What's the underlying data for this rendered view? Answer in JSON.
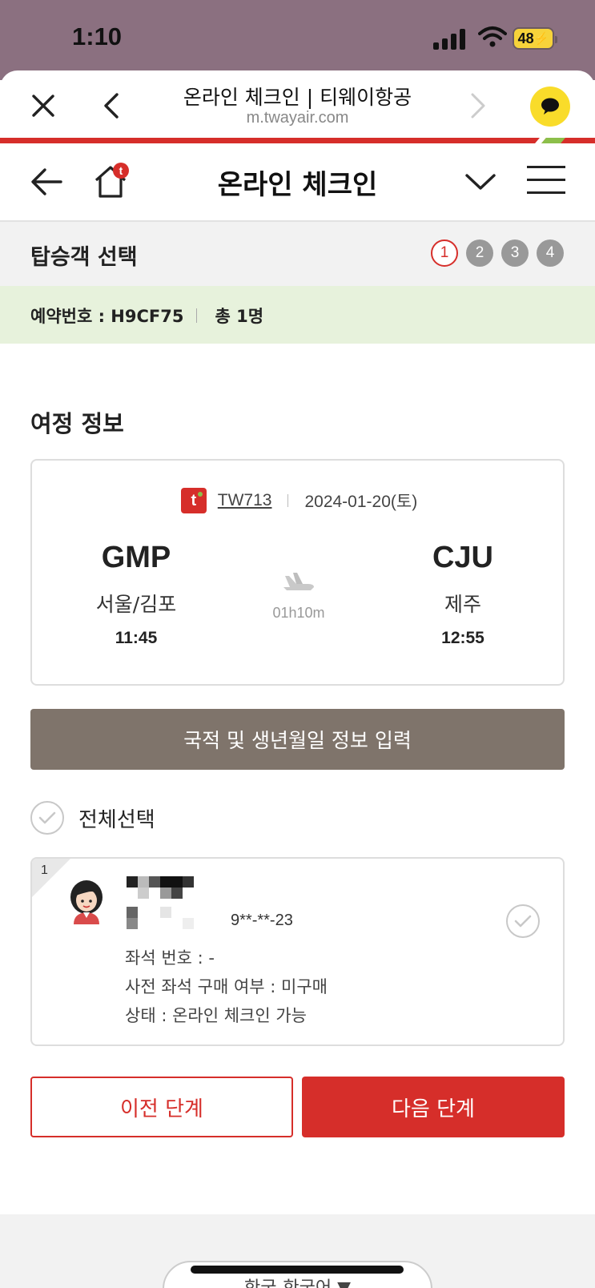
{
  "status_bar": {
    "time": "1:10",
    "battery": "48"
  },
  "browser": {
    "title": "온라인 체크인 | 티웨이항공",
    "url": "m.twayair.com"
  },
  "app_nav": {
    "title": "온라인 체크인"
  },
  "steps": {
    "label": "탑승객 선택",
    "items": [
      "1",
      "2",
      "3",
      "4"
    ],
    "active": 1
  },
  "reservation": {
    "number_label": "예약번호 : H9CF75",
    "total_label": "총 1명"
  },
  "itinerary": {
    "section_title": "여정 정보",
    "logo_letter": "t",
    "flight_no": "TW713",
    "date": "2024-01-20(토)",
    "origin": {
      "code": "GMP",
      "city": "서울/김포",
      "time": "11:45"
    },
    "destination": {
      "code": "CJU",
      "city": "제주",
      "time": "12:55"
    },
    "duration": "01h10m"
  },
  "nationality_button": "국적 및 생년월일 정보 입력",
  "select_all": "전체선택",
  "passenger": {
    "index": "1",
    "birth_masked": "9**-**-23",
    "seat": "좌석 번호 : -",
    "pre_seat": "사전 좌석 구매 여부 : 미구매",
    "status": "상태 : 온라인 체크인 가능"
  },
  "buttons": {
    "prev": "이전 단계",
    "next": "다음 단계"
  },
  "footer": {
    "language": "한국-한국어 ▼"
  },
  "colors": {
    "brand_red": "#d62e2a",
    "brand_green": "#8cbf4a",
    "button_brown": "#7f746b",
    "kakao_yellow": "#f9dc2a"
  }
}
